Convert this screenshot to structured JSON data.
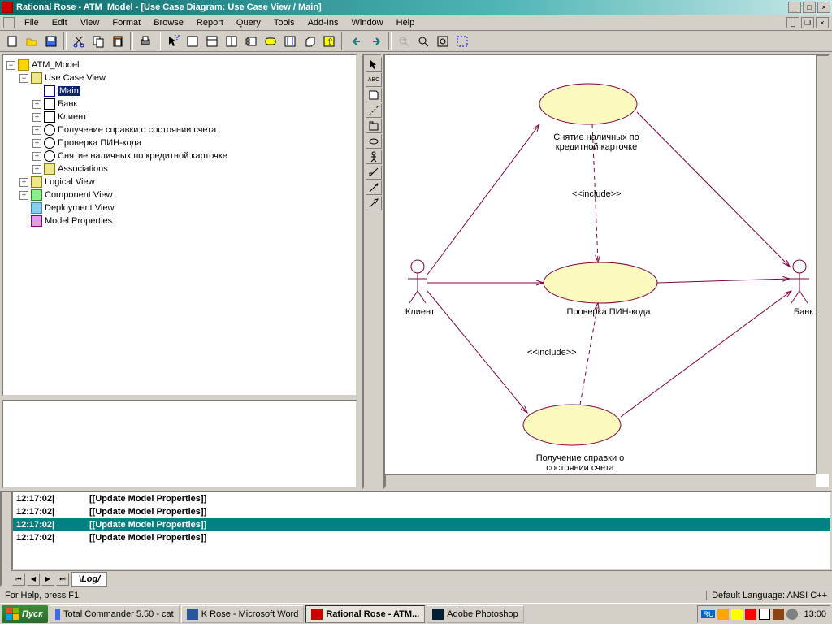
{
  "title": "Rational Rose - ATM_Model - [Use Case Diagram: Use Case View / Main]",
  "menu": [
    "File",
    "Edit",
    "View",
    "Format",
    "Browse",
    "Report",
    "Query",
    "Tools",
    "Add-Ins",
    "Window",
    "Help"
  ],
  "tree": {
    "root": "ATM_Model",
    "ucv": "Use Case View",
    "main": "Main",
    "bank": "Банк",
    "client": "Клиент",
    "uc1": "Получение справки о состоянии счета",
    "uc2": "Проверка ПИН-кода",
    "uc3": "Снятие наличных по кредитной карточке",
    "assoc": "Associations",
    "lv": "Logical View",
    "cv": "Component View",
    "dv": "Deployment View",
    "mp": "Model Properties"
  },
  "diagram": {
    "client_label": "Клиент",
    "bank_label": "Банк",
    "uc_top": "Снятие наличных по\nкредитной карточке",
    "uc_mid": "Проверка ПИН-кода",
    "uc_bot": "Получение справки о\nсостоянии счета",
    "include": "<<include>>"
  },
  "log": {
    "rows": [
      {
        "t": "12:17:02|",
        "m": "[[Update Model Properties]]"
      },
      {
        "t": "12:17:02|",
        "m": "[[Update Model Properties]]"
      },
      {
        "t": "12:17:02|",
        "m": "[[Update Model Properties]]"
      },
      {
        "t": "12:17:02|",
        "m": "[[Update Model Properties]]"
      }
    ],
    "tab": "Log"
  },
  "status": {
    "help": "For Help, press F1",
    "lang": "Default Language: ANSI C++"
  },
  "taskbar": {
    "start": "Пуск",
    "tasks": [
      {
        "icon": "save",
        "label": "Total Commander 5.50 - cat"
      },
      {
        "icon": "word",
        "label": "K Rose - Microsoft Word"
      },
      {
        "icon": "rose",
        "label": "Rational Rose - ATM..."
      },
      {
        "icon": "ps",
        "label": "Adobe Photoshop"
      }
    ],
    "lang_ind": "RU",
    "clock": "13:00"
  }
}
